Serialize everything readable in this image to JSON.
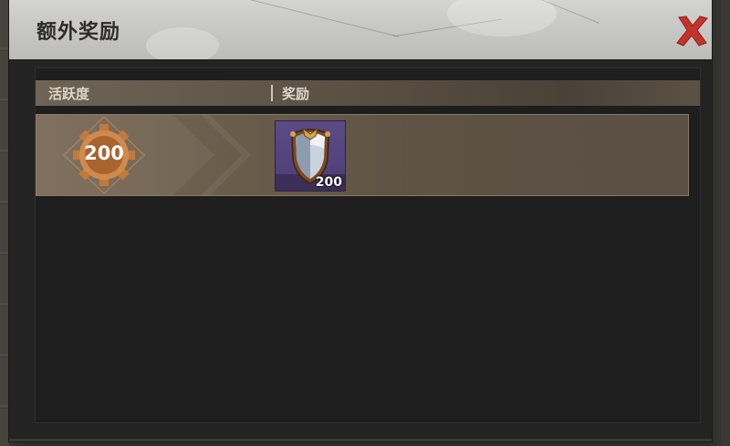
{
  "dialog": {
    "title": "额外奖励",
    "close_icon": "close-x-icon",
    "accent_color": "#c4332a"
  },
  "table": {
    "headers": {
      "activity": "活跃度",
      "reward": "奖励"
    },
    "rows": [
      {
        "activity": "200",
        "activity_icon": "gear-badge-icon",
        "reward_icon": "shield-icon",
        "reward_count": "200"
      }
    ]
  }
}
